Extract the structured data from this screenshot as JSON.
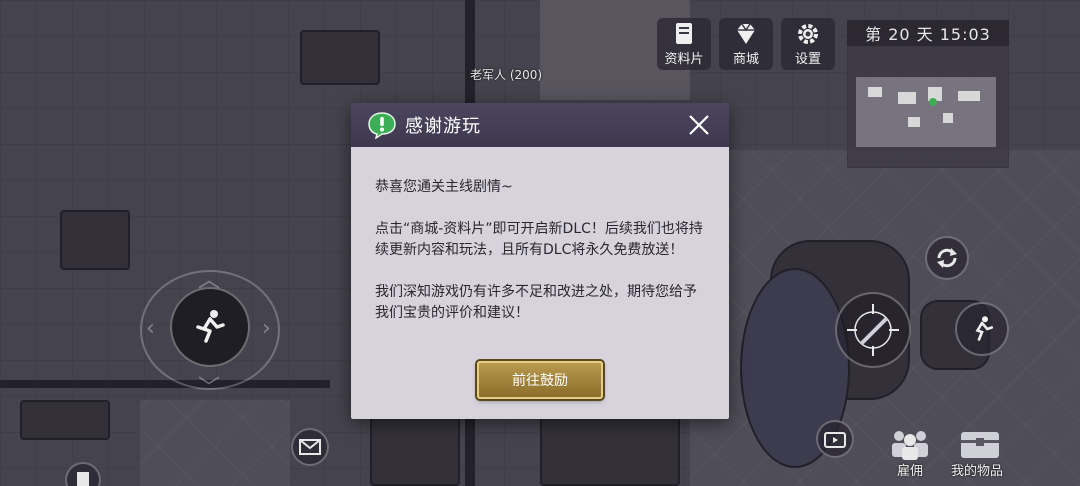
{
  "hud": {
    "materials_label": "资料片",
    "shop_label": "商城",
    "settings_label": "设置",
    "day_clock": "第 20 天 15:03"
  },
  "map": {
    "npc_label": "老军人 (200)"
  },
  "bottom_bar": {
    "hire_label": "雇佣",
    "items_label": "我的物品"
  },
  "dialog": {
    "title": "感谢游玩",
    "paragraphs": [
      "恭喜您通关主线剧情~",
      "点击“商城-资料片”即可开启新DLC！后续我们也将持续更新内容和玩法，且所有DLC将永久免费放送！",
      "我们深知游戏仍有许多不足和改进之处，期待您给予我们宝贵的评价和建议！"
    ],
    "confirm_label": "前往鼓励"
  },
  "colors": {
    "dialog_header": "#443e56",
    "dialog_body": "#d6d3dd",
    "button_gold": "#a8893f",
    "icon_green": "#3cae55"
  },
  "icons": [
    "book-icon",
    "diamond-icon",
    "gear-icon",
    "exclamation-icon",
    "close-icon",
    "run-icon",
    "refresh-icon",
    "mail-icon",
    "tv-icon",
    "crowd-icon",
    "chest-icon",
    "door-icon",
    "crosshair-icon"
  ]
}
